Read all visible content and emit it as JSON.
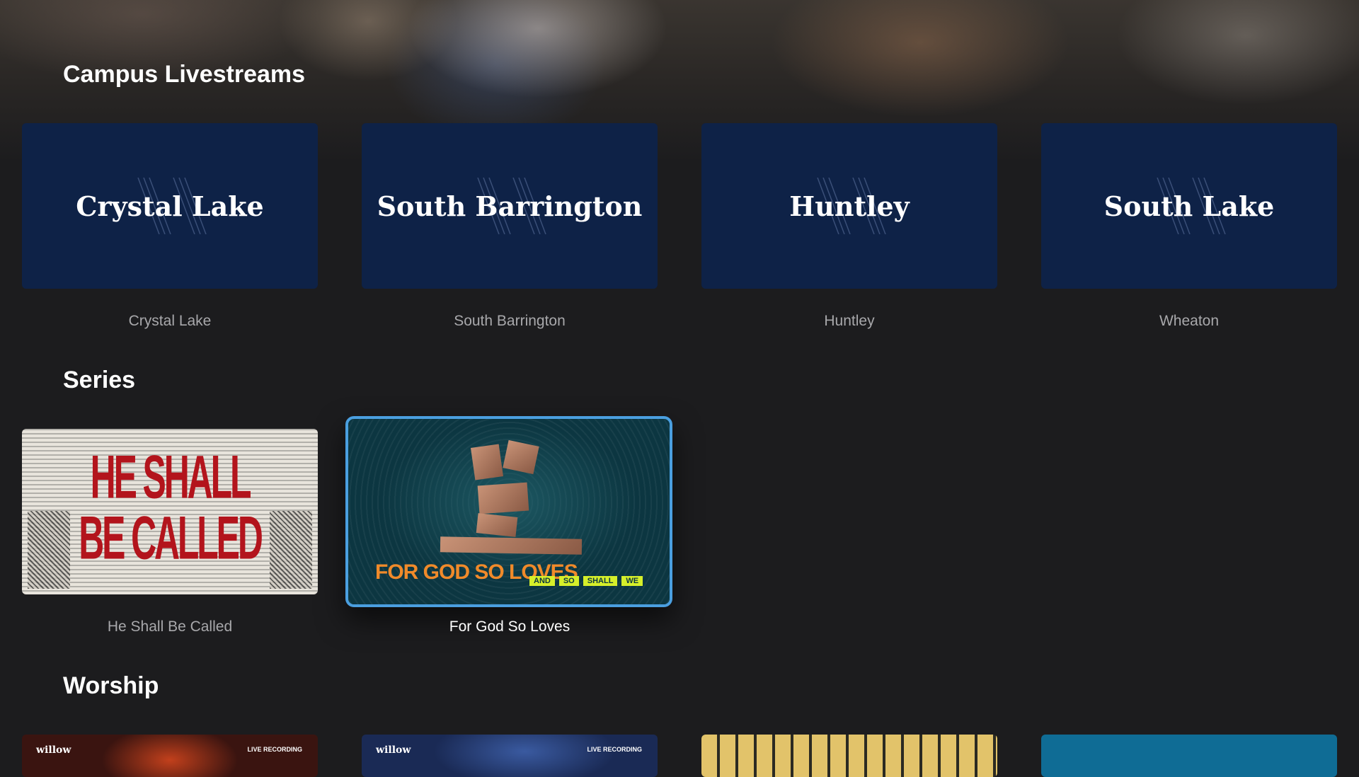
{
  "sections": {
    "campus": {
      "title": "Campus Livestreams",
      "items": [
        {
          "tile_text": "Crystal Lake",
          "caption": "Crystal Lake"
        },
        {
          "tile_text": "South Barrington",
          "caption": "South Barrington"
        },
        {
          "tile_text": "Huntley",
          "caption": "Huntley"
        },
        {
          "tile_text": "South Lake",
          "caption": "Wheaton"
        }
      ]
    },
    "series": {
      "title": "Series",
      "items": [
        {
          "caption": "He Shall Be Called",
          "art_line1": "HE SHALL",
          "art_line2": "BE CALLED"
        },
        {
          "caption": "For God So Loves",
          "art_title": "FOR GOD SO LOVES",
          "art_tags": [
            "AND",
            "SO",
            "SHALL",
            "WE"
          ],
          "focused": true
        }
      ]
    },
    "worship": {
      "title": "Worship",
      "items": [
        {
          "brand": "willow",
          "badge": "LIVE RECORDING"
        },
        {
          "brand": "willow",
          "badge": "LIVE RECORDING"
        },
        {
          "brand": "",
          "badge": ""
        },
        {
          "brand": "",
          "badge": ""
        }
      ]
    }
  },
  "colors": {
    "background": "#1c1c1e",
    "campus_tile": "#0e2247",
    "focus_ring": "#4a9fe0",
    "caption": "#a8a8ab",
    "series_red": "#b3141c",
    "series_orange": "#f08a2a",
    "series_lime": "#d6ef2a"
  }
}
